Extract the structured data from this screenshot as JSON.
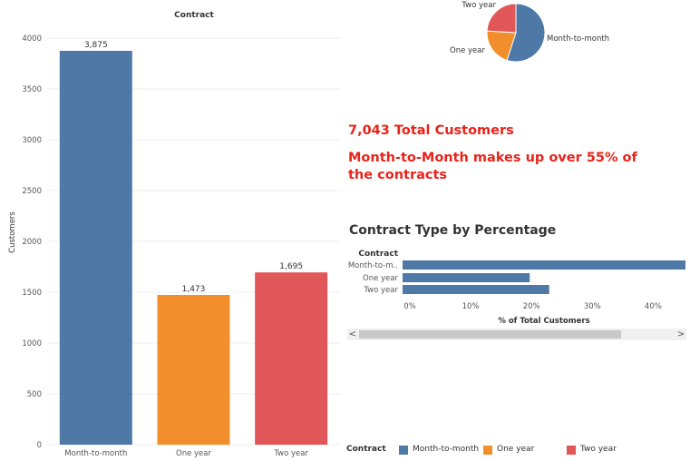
{
  "chart_data": [
    {
      "type": "bar",
      "title": "Contract",
      "ylabel": "Customers",
      "xlabel": "",
      "categories": [
        "Month-to-month",
        "One year",
        "Two year"
      ],
      "values": [
        3875,
        1473,
        1695
      ],
      "value_labels": [
        "3,875",
        "1,473",
        "1,695"
      ],
      "colors": [
        "#4e79a7",
        "#f28e2b",
        "#e15759"
      ],
      "ylim": [
        0,
        4000
      ],
      "yticks": [
        0,
        500,
        1000,
        1500,
        2000,
        2500,
        3000,
        3500,
        4000
      ],
      "grid": true
    },
    {
      "type": "pie",
      "categories": [
        "Month-to-month",
        "One year",
        "Two year"
      ],
      "values": [
        3875,
        1473,
        1695
      ],
      "colors": [
        "#4e79a7",
        "#f28e2b",
        "#e15759"
      ]
    },
    {
      "type": "bar",
      "orientation": "horizontal",
      "title": "Contract Type by Percentage",
      "category_header": "Contract",
      "categories": [
        "Month-to-m..",
        "One year",
        "Two year"
      ],
      "values": [
        55.0,
        20.9,
        24.1
      ],
      "xlabel": "% of Total Customers",
      "xticks": [
        "0%",
        "10%",
        "20%",
        "30%",
        "40%"
      ],
      "xlim": [
        0,
        46.5
      ],
      "color": "#4e79a7"
    }
  ],
  "headlines": {
    "total": "7,043 Total Customers",
    "share": "Month-to-Month makes up over 55% of the contracts"
  },
  "legend": {
    "title": "Contract",
    "items": [
      {
        "label": "Month-to-month",
        "color": "#4e79a7"
      },
      {
        "label": "One year",
        "color": "#f28e2b"
      },
      {
        "label": "Two year",
        "color": "#e15759"
      }
    ]
  },
  "scrollbar": {
    "left_arrow": "<",
    "right_arrow": ">"
  }
}
